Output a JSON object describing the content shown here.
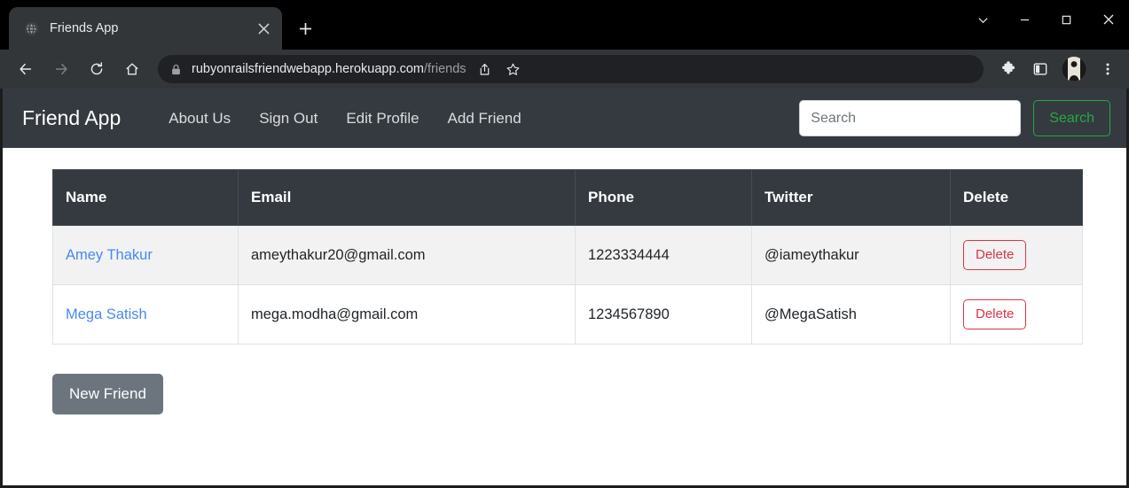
{
  "browser": {
    "tab": {
      "title": "Friends App",
      "favicon_icon": "globe-icon",
      "close_icon": "close-icon"
    },
    "new_tab_icon": "plus-icon",
    "window_controls": {
      "tab_search_icon": "chevron-down-icon",
      "minimize_icon": "minimize-icon",
      "maximize_icon": "maximize-icon",
      "close_icon": "close-icon"
    },
    "toolbar": {
      "back_icon": "back-arrow-icon",
      "forward_icon": "forward-arrow-icon",
      "reload_icon": "reload-icon",
      "home_icon": "home-icon",
      "lock_icon": "lock-icon",
      "url_domain": "rubyonrailsfriendwebapp.herokuapp.com",
      "url_path": "/friends",
      "share_icon": "share-icon",
      "bookmark_icon": "star-icon",
      "extensions_icon": "puzzle-piece-icon",
      "side_panel_icon": "side-panel-icon",
      "profile_icon": "avatar-icon",
      "menu_icon": "three-dot-menu-icon"
    }
  },
  "app": {
    "brand": "Friend App",
    "nav_links": [
      {
        "label": "About Us"
      },
      {
        "label": "Sign Out"
      },
      {
        "label": "Edit Profile"
      },
      {
        "label": "Add Friend"
      }
    ],
    "search": {
      "value": "",
      "placeholder": "Search",
      "button_label": "Search"
    },
    "table": {
      "columns": [
        "Name",
        "Email",
        "Phone",
        "Twitter",
        "Delete"
      ],
      "rows": [
        {
          "name": "Amey Thakur",
          "email": "ameythakur20@gmail.com",
          "phone": "1223334444",
          "twitter": "@iameythakur",
          "delete_label": "Delete"
        },
        {
          "name": "Mega Satish",
          "email": "mega.modha@gmail.com",
          "phone": "1234567890",
          "twitter": "@MegaSatish",
          "delete_label": "Delete"
        }
      ]
    },
    "new_friend_label": "New Friend",
    "colors": {
      "navbar_bg": "#343a40",
      "link": "#4a89f3",
      "success": "#28a745",
      "danger": "#dc3545",
      "secondary": "#6c757d"
    }
  }
}
